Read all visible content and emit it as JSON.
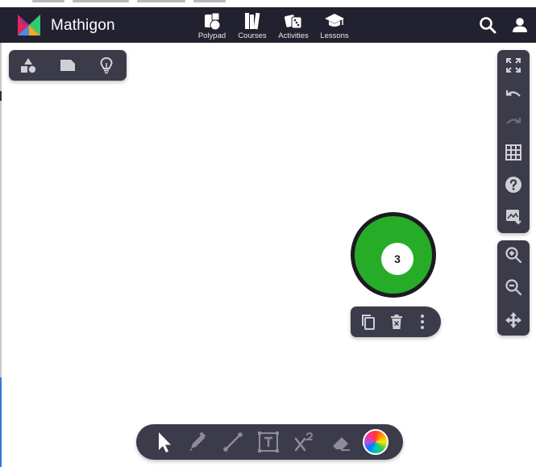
{
  "brand": {
    "name": "Mathigon",
    "colors": [
      "#e6255d",
      "#f5a623",
      "#4a90e2",
      "#2ecc71"
    ]
  },
  "nav": {
    "items": [
      {
        "label": "Polypad",
        "icon": "polypad-icon"
      },
      {
        "label": "Courses",
        "icon": "courses-icon"
      },
      {
        "label": "Activities",
        "icon": "activities-icon"
      },
      {
        "label": "Lessons",
        "icon": "lessons-icon"
      }
    ],
    "search_icon": "search-icon",
    "account_icon": "user-icon"
  },
  "left_toolbar": [
    "shapes-icon",
    "card-icon",
    "lightbulb-icon"
  ],
  "right_toolbar_top": [
    "fullscreen-icon",
    "undo-icon",
    "redo-icon",
    "grid-icon",
    "help-icon",
    "download-image-icon"
  ],
  "right_toolbar_bottom": [
    "zoom-in-icon",
    "zoom-out-icon",
    "pan-icon"
  ],
  "canvas": {
    "selected_tile": {
      "label": "3",
      "fill": "#27ac28",
      "stroke": "#1c1b22"
    }
  },
  "context_menu": [
    "duplicate-icon",
    "delete-icon",
    "more-icon"
  ],
  "bottom_toolbar": [
    "select-icon",
    "pen-icon",
    "line-icon",
    "text-icon",
    "equation-icon",
    "eraser-icon",
    "color-picker-icon"
  ],
  "colors": {
    "navbar": "#22212f",
    "panel": "#3c3b4a",
    "icon": "#cfcfd6",
    "icon_disabled": "#6e6d7a"
  }
}
